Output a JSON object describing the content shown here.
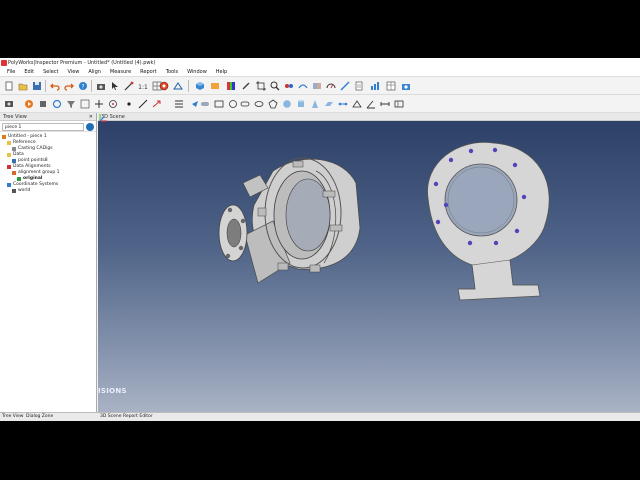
{
  "window": {
    "title": "PolyWorks|Inspector Premium - Untitled* (Untitled (4).pwk)"
  },
  "menu": [
    "File",
    "Edit",
    "Select",
    "View",
    "Align",
    "Measure",
    "Report",
    "Tools",
    "Window",
    "Help"
  ],
  "tree_view": {
    "header": "Tree View",
    "search_value": "piece 1",
    "items": [
      {
        "label": "Untitled - piece 1",
        "indent": 0,
        "icon": "workspace-icon"
      },
      {
        "label": "Reference",
        "indent": 1,
        "icon": "folder-icon"
      },
      {
        "label": "Casting CADigs",
        "indent": 2,
        "icon": "cad-icon"
      },
      {
        "label": "Data",
        "indent": 1,
        "icon": "folder-icon"
      },
      {
        "label": "point points8",
        "indent": 2,
        "icon": "points-icon"
      },
      {
        "label": "Data Alignments",
        "indent": 1,
        "icon": "alignment-icon"
      },
      {
        "label": "alignment group 1",
        "indent": 2,
        "icon": "alignment-group-icon"
      },
      {
        "label": "original",
        "indent": 3,
        "icon": "check-icon",
        "bold": true
      },
      {
        "label": "Coordinate Systems",
        "indent": 1,
        "icon": "coordinate-icon"
      },
      {
        "label": "world",
        "indent": 2,
        "icon": "axis-icon"
      }
    ]
  },
  "scene": {
    "header": "3D Scene",
    "watermark": "ISIONS"
  },
  "bottom_tabs": [
    "Tree View",
    "Dialog Zone",
    "3D Scene",
    "Report Editor"
  ],
  "colors": {
    "scene_top": "#2b3e66",
    "scene_bottom": "#a9b3c5",
    "part": "#d6d6d6",
    "feature_dot": "#5044b8"
  }
}
